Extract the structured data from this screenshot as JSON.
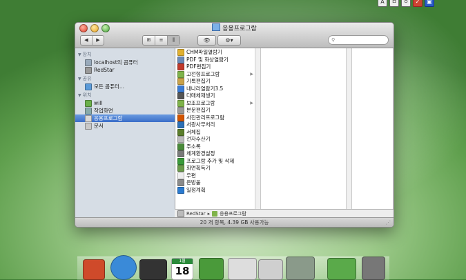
{
  "window": {
    "title": "응용프로그람",
    "status": "20 개 항목, 4.39 GB 사용가능"
  },
  "sidebar": {
    "sections": [
      {
        "heading": "장치",
        "items": [
          {
            "label": "localhost의 콤퓨터",
            "icon": "computer-icon"
          },
          {
            "label": "RedStar",
            "icon": "disk-icon"
          }
        ]
      },
      {
        "heading": "공유",
        "items": [
          {
            "label": "모든 콤퓨터...",
            "icon": "network-icon"
          }
        ]
      },
      {
        "heading": "위치",
        "items": [
          {
            "label": "will",
            "icon": "home-icon"
          },
          {
            "label": "작업화면",
            "icon": "desktop-icon"
          },
          {
            "label": "응용프로그람",
            "icon": "applications-icon",
            "selected": true
          },
          {
            "label": "문서",
            "icon": "documents-icon"
          }
        ]
      }
    ]
  },
  "apps": [
    {
      "label": "CHM파일열람기",
      "icon": "chm-icon",
      "color": "#e0b030"
    },
    {
      "label": "PDF 및 화상열람기",
      "icon": "pdf-icon",
      "color": "#6a8ab8"
    },
    {
      "label": "PDF편집기",
      "icon": "pdf-edit-icon",
      "color": "#c0392b"
    },
    {
      "label": "고전형프로그람",
      "icon": "folder-icon",
      "color": "#7fb34a",
      "folder": true
    },
    {
      "label": "기록편집기",
      "icon": "notes-icon",
      "color": "#c9a24a"
    },
    {
      "label": "내나라열람기3.5",
      "icon": "browser-icon",
      "color": "#3a7bd5"
    },
    {
      "label": "다매체재생기",
      "icon": "media-icon",
      "color": "#555555"
    },
    {
      "label": "보조프로그람",
      "icon": "folder-icon",
      "color": "#7fb34a",
      "folder": true
    },
    {
      "label": "본문편집기",
      "icon": "text-icon",
      "color": "#999999"
    },
    {
      "label": "사진관리프로그람",
      "icon": "photo-icon",
      "color": "#d35400"
    },
    {
      "label": "서광사무처리",
      "icon": "office-icon",
      "color": "#2c6fb5"
    },
    {
      "label": "서체집",
      "icon": "font-icon",
      "color": "#5a7d2a"
    },
    {
      "label": "전자수산기",
      "icon": "calculator-icon",
      "color": "#bbbbbb"
    },
    {
      "label": "주소록",
      "icon": "addressbook-icon",
      "color": "#4a8a3a"
    },
    {
      "label": "체계환경설정",
      "icon": "settings-icon",
      "color": "#7a7a7a"
    },
    {
      "label": "프로그람 추가 및 삭제",
      "icon": "install-icon",
      "color": "#3a9a3a"
    },
    {
      "label": "화면획득기",
      "icon": "screenshot-icon",
      "color": "#6a9a4a"
    },
    {
      "label": "우편",
      "icon": "mail-icon",
      "color": "#eeeeee"
    },
    {
      "label": "은방울",
      "icon": "bell-icon",
      "color": "#8a8a8a"
    },
    {
      "label": "일정계획",
      "icon": "calendar-icon",
      "color": "#2a7ad0"
    }
  ],
  "pathbar": {
    "disk": "RedStar",
    "folder": "응용프로그람"
  },
  "search": {
    "placeholder": ""
  },
  "dock": {
    "calendar_month": "1월",
    "calendar_day": "18",
    "items": [
      {
        "name": "finder-dock-icon",
        "color": "#cf4a2a"
      },
      {
        "name": "globe-dock-icon",
        "color": "#3a8ad8"
      },
      {
        "name": "media-dock-icon",
        "color": "#333333"
      },
      {
        "name": "calendar-dock-icon",
        "color": "#ffffff"
      },
      {
        "name": "addressbook-dock-icon",
        "color": "#4a9a3a"
      },
      {
        "name": "preview-dock-icon",
        "color": "#dddddd"
      },
      {
        "name": "calculator-dock-icon",
        "color": "#cfcfcf"
      },
      {
        "name": "settings-dock-icon",
        "color": "#8a9a8a"
      },
      {
        "name": "installer-dock-icon",
        "color": "#5aaa4a"
      },
      {
        "name": "trash-dock-icon",
        "color": "#777777"
      }
    ]
  },
  "menubar_extras": [
    "A",
    "ㅁ",
    "ㅇ",
    "✓",
    "▣"
  ]
}
